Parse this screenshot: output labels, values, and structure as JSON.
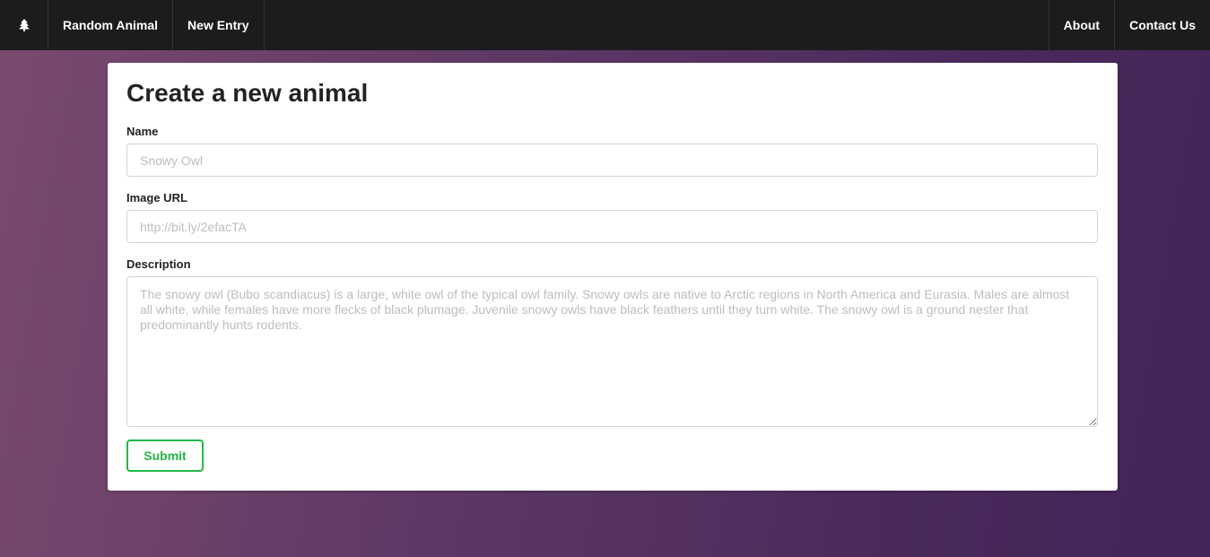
{
  "navbar": {
    "logo_icon": "tree-icon",
    "left_items": [
      {
        "label": "Random Animal"
      },
      {
        "label": "New Entry"
      }
    ],
    "right_items": [
      {
        "label": "About"
      },
      {
        "label": "Contact Us"
      }
    ]
  },
  "form": {
    "title": "Create a new animal",
    "name": {
      "label": "Name",
      "value": "",
      "placeholder": "Snowy Owl"
    },
    "image_url": {
      "label": "Image URL",
      "value": "",
      "placeholder": "http://bit.ly/2efacTA"
    },
    "description": {
      "label": "Description",
      "value": "",
      "placeholder": "The snowy owl (Bubo scandiacus) is a large, white owl of the typical owl family. Snowy owls are native to Arctic regions in North America and Eurasia. Males are almost all white, while females have more flecks of black plumage. Juvenile snowy owls have black feathers until they turn white. The snowy owl is a ground nester that predominantly hunts rodents."
    },
    "submit_label": "Submit"
  },
  "colors": {
    "navbar_bg": "#1b1c1d",
    "submit_accent": "#21ba45",
    "gradient_start": "#7b4a6e",
    "gradient_end": "#43255a"
  }
}
